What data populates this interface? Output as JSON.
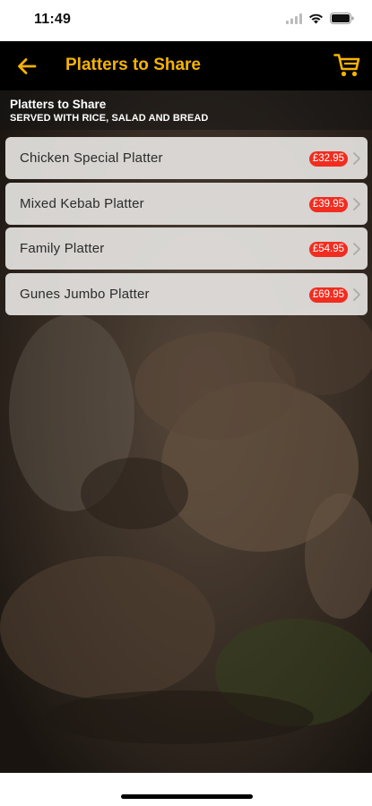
{
  "status_bar": {
    "time": "11:49"
  },
  "nav": {
    "title": "Platters to Share"
  },
  "section": {
    "title": "Platters to Share",
    "subtitle": "SERVED WITH RICE, SALAD AND BREAD"
  },
  "items": [
    {
      "name": "Chicken Special Platter",
      "price": "£32.95"
    },
    {
      "name": "Mixed Kebab Platter",
      "price": "£39.95"
    },
    {
      "name": "Family Platter",
      "price": "£54.95"
    },
    {
      "name": "Gunes Jumbo Platter",
      "price": "£69.95"
    }
  ],
  "colors": {
    "accent": "#f5b301",
    "price_badge": "#f12d20",
    "nav_background": "#000000"
  },
  "icons": [
    "back-arrow-icon",
    "cart-icon",
    "chevron-right-icon",
    "signal-icon",
    "wifi-icon",
    "battery-icon"
  ]
}
